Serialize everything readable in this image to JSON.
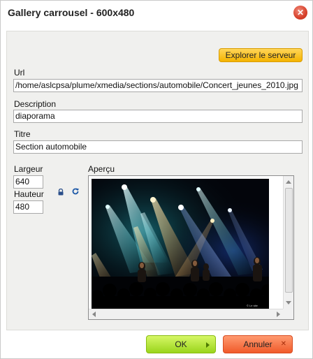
{
  "dialog": {
    "title": "Gallery carrousel - 600x480",
    "close_icon": "close-icon"
  },
  "browse": {
    "label": "Explorer le serveur"
  },
  "form": {
    "url_label": "Url",
    "url_value": "/home/aslcpsa/plume/xmedia/sections/automobile/Concert_jeunes_2010.jpg",
    "description_label": "Description",
    "description_value": "diaporama",
    "title_label": "Titre",
    "title_value": "Section automobile",
    "width_label": "Largeur",
    "width_value": "640",
    "height_label": "Hauteur",
    "height_value": "480",
    "lock_icon": "lock-icon",
    "reset_icon": "reset-size-icon"
  },
  "preview": {
    "label": "Aperçu",
    "watermark": "© Le site"
  },
  "footer": {
    "ok_label": "OK",
    "cancel_label": "Annuler"
  },
  "colors": {
    "ok": "#9ad51c",
    "cancel": "#f05a2a",
    "browse": "#f4b300"
  }
}
